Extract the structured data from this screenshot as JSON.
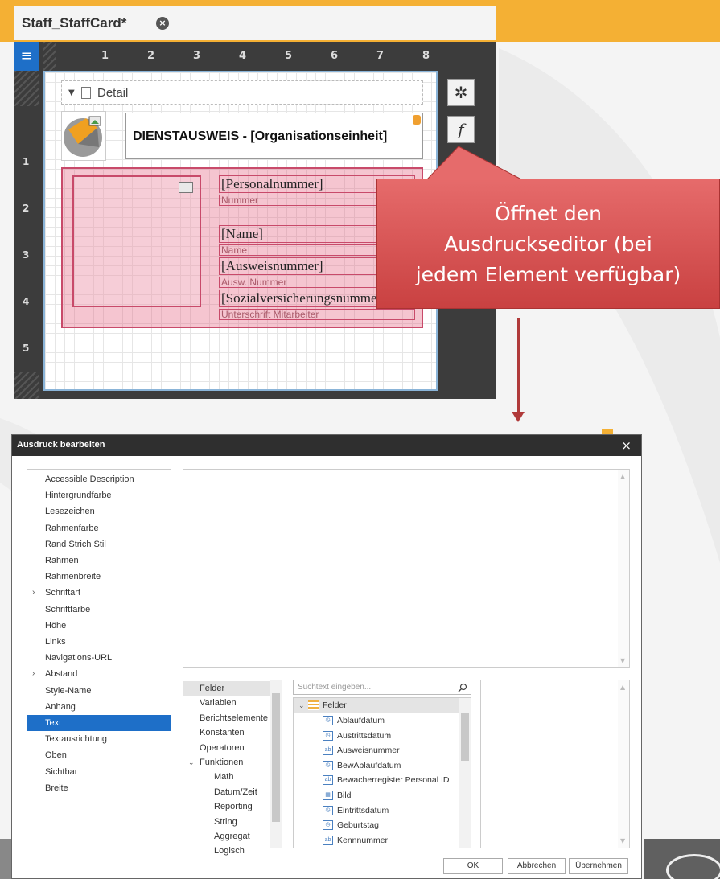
{
  "designer": {
    "tab_title": "Staff_StaffCard*",
    "ruler_top": [
      "1",
      "2",
      "3",
      "4",
      "5",
      "6",
      "7",
      "8"
    ],
    "ruler_left": [
      "1",
      "2",
      "3",
      "4",
      "5"
    ],
    "band_label": "Detail",
    "title_text": "DIENSTAUSWEIS - [Organisationseinheit]",
    "fields": [
      {
        "text": "[Personalnummer]",
        "kind": "big"
      },
      {
        "text": "Nummer",
        "kind": "small"
      },
      {
        "text": "[Name]",
        "kind": "big"
      },
      {
        "text": "Name",
        "kind": "small"
      },
      {
        "text": "[Ausweisnummer]",
        "kind": "big"
      },
      {
        "text": "Ausw. Nummer",
        "kind": "small"
      },
      {
        "text": "[Sozialversicherungsnummer]",
        "kind": "big"
      },
      {
        "text": "Unterschrift Mitarbeiter",
        "kind": "small"
      }
    ],
    "side_buttons": {
      "settings_icon": "gear-icon",
      "expression_label": "f"
    }
  },
  "callout": {
    "lines": [
      "Öffnet den",
      "Ausdruckseditor (bei",
      "jedem Element verfügbar)"
    ]
  },
  "dialog": {
    "title": "Ausdruck bearbeiten",
    "close_label": "×",
    "properties": [
      {
        "label": "Accessible Description",
        "expandable": false,
        "selected": false
      },
      {
        "label": "Hintergrundfarbe",
        "expandable": false,
        "selected": false
      },
      {
        "label": "Lesezeichen",
        "expandable": false,
        "selected": false
      },
      {
        "label": "Rahmenfarbe",
        "expandable": false,
        "selected": false
      },
      {
        "label": "Rand Strich Stil",
        "expandable": false,
        "selected": false
      },
      {
        "label": "Rahmen",
        "expandable": false,
        "selected": false
      },
      {
        "label": "Rahmenbreite",
        "expandable": false,
        "selected": false
      },
      {
        "label": "Schriftart",
        "expandable": true,
        "selected": false
      },
      {
        "label": "Schriftfarbe",
        "expandable": false,
        "selected": false
      },
      {
        "label": "Höhe",
        "expandable": false,
        "selected": false
      },
      {
        "label": "Links",
        "expandable": false,
        "selected": false
      },
      {
        "label": "Navigations-URL",
        "expandable": false,
        "selected": false
      },
      {
        "label": "Abstand",
        "expandable": true,
        "selected": false
      },
      {
        "label": "Style-Name",
        "expandable": false,
        "selected": false
      },
      {
        "label": "Anhang",
        "expandable": false,
        "selected": false
      },
      {
        "label": "Text",
        "expandable": false,
        "selected": true
      },
      {
        "label": "Textausrichtung",
        "expandable": false,
        "selected": false
      },
      {
        "label": "Oben",
        "expandable": false,
        "selected": false
      },
      {
        "label": "Sichtbar",
        "expandable": false,
        "selected": false
      },
      {
        "label": "Breite",
        "expandable": false,
        "selected": false
      }
    ],
    "categories": [
      {
        "label": "Felder",
        "level": 0,
        "selected": true
      },
      {
        "label": "Variablen",
        "level": 0,
        "selected": false
      },
      {
        "label": "Berichtselemente",
        "level": 0,
        "selected": false
      },
      {
        "label": "Konstanten",
        "level": 0,
        "selected": false
      },
      {
        "label": "Operatoren",
        "level": 0,
        "selected": false
      },
      {
        "label": "Funktionen",
        "level": 0,
        "selected": false,
        "expanded": true
      },
      {
        "label": "Math",
        "level": 1,
        "selected": false
      },
      {
        "label": "Datum/Zeit",
        "level": 1,
        "selected": false
      },
      {
        "label": "Reporting",
        "level": 1,
        "selected": false
      },
      {
        "label": "String",
        "level": 1,
        "selected": false
      },
      {
        "label": "Aggregat",
        "level": 1,
        "selected": false
      },
      {
        "label": "Logisch",
        "level": 1,
        "selected": false
      }
    ],
    "search_placeholder": "Suchtext eingeben...",
    "fields_root": "Felder",
    "fields": [
      {
        "label": "Ablaufdatum",
        "icon": "clock"
      },
      {
        "label": "Austrittsdatum",
        "icon": "clock"
      },
      {
        "label": "Ausweisnummer",
        "icon": "ab"
      },
      {
        "label": "BewAblaufdatum",
        "icon": "clock"
      },
      {
        "label": "Bewacherregister Personal ID",
        "icon": "ab"
      },
      {
        "label": "Bild",
        "icon": "image"
      },
      {
        "label": "Eintrittsdatum",
        "icon": "clock"
      },
      {
        "label": "Geburtstag",
        "icon": "clock"
      },
      {
        "label": "Kennnummer",
        "icon": "ab"
      }
    ],
    "buttons": {
      "ok": "OK",
      "cancel": "Abbrechen",
      "apply": "Übernehmen"
    }
  }
}
